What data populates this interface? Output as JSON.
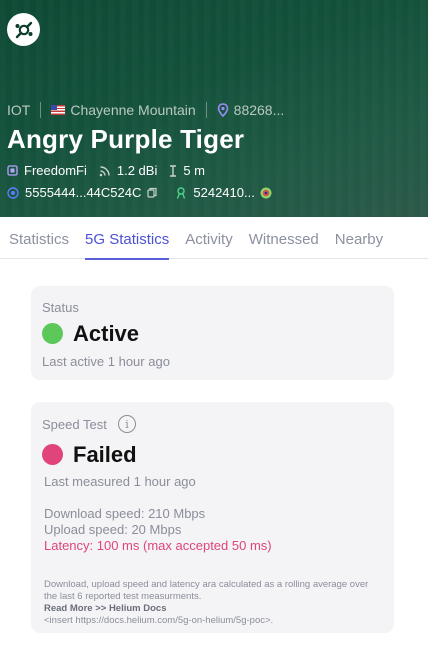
{
  "header": {
    "network": "IOT",
    "location": "Chayenne Mountain",
    "hex": "88268...",
    "hotspot_name": "Angry Purple Tiger",
    "maker": "FreedomFi",
    "antenna_gain": "1.2 dBi",
    "elevation": "5 m",
    "wallet_address": "5555444...44C524C",
    "owner_address": "5242410..."
  },
  "tabs": [
    {
      "label": "Statistics",
      "active": false
    },
    {
      "label": "5G Statistics",
      "active": true
    },
    {
      "label": "Activity",
      "active": false
    },
    {
      "label": "Witnessed",
      "active": false
    },
    {
      "label": "Nearby",
      "active": false
    }
  ],
  "status_card": {
    "label": "Status",
    "value": "Active",
    "color": "#5cc85a",
    "last_active": "Last active 1 hour ago"
  },
  "speed_card": {
    "label": "Speed Test",
    "info_glyph": "i",
    "value": "Failed",
    "color": "#e0447a",
    "last_measured": "Last measured 1 hour ago",
    "download": "Download speed: 210 Mbps",
    "upload": "Upload speed: 20 Mbps",
    "latency": "Latency: 100 ms (max accepted 50 ms)",
    "note": "Download, upload speed and latency ara calculated as a rolling average over the last 6 reported test measurments.",
    "read_more": "Read More >> Helium Docs",
    "link": "<insert https://docs.helium.com/5g-on-helium/5g-poc>."
  },
  "colors": {
    "accent": "#4a52d3",
    "header_bg": "#14523c",
    "card_bg": "#f4f4f6"
  }
}
